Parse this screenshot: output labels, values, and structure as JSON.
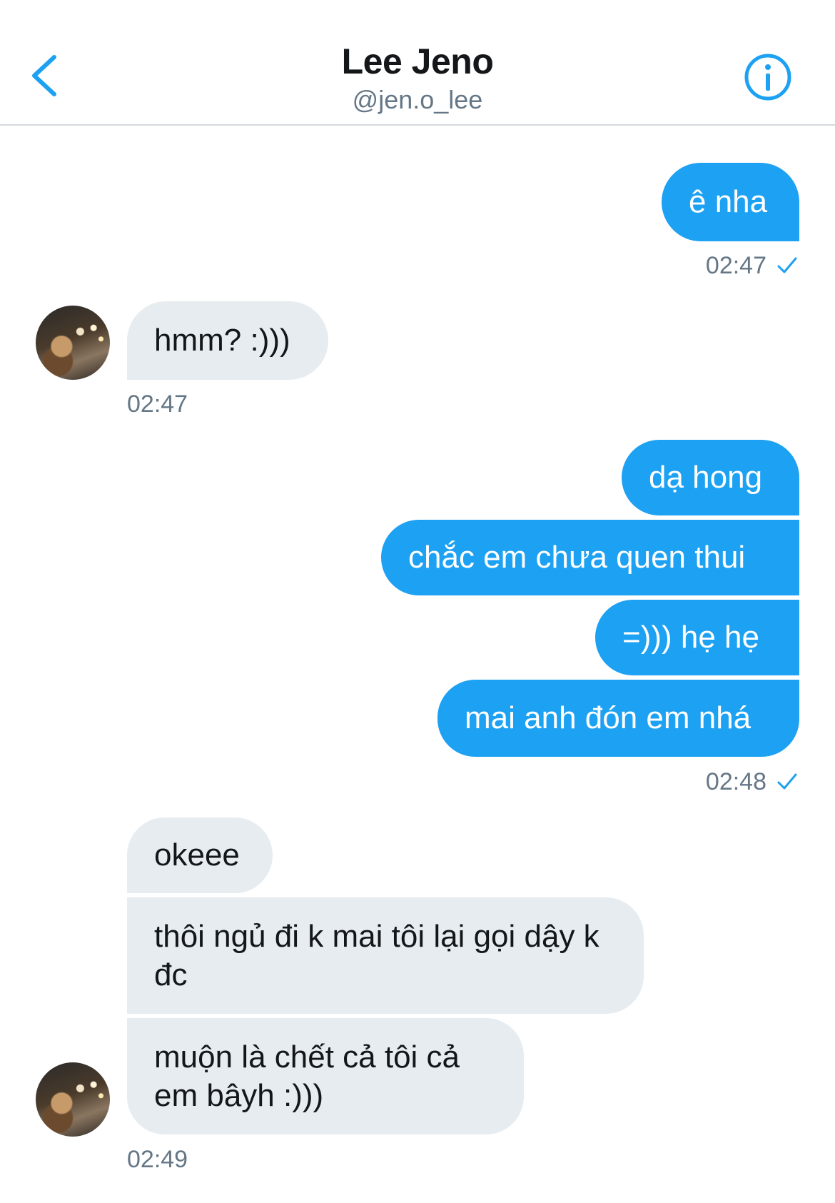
{
  "header": {
    "title": "Lee Jeno",
    "handle": "@jen.o_lee",
    "back_icon": "chevron-left-icon",
    "info_icon": "info-icon",
    "accent_color": "#1da1f2"
  },
  "messages": {
    "m1": "ê nha",
    "t1": "02:47",
    "m2": "hmm? :)))",
    "t2": "02:47",
    "m3": "dạ hong",
    "m4": "chắc em chưa quen thui",
    "m5": "=))) hẹ hẹ",
    "m6": "mai anh đón em nhá",
    "t3": "02:48",
    "m7": "okeee",
    "m8": "thôi ngủ đi k mai tôi lại gọi dậy k đc",
    "m9": "muộn là chết cả tôi cả em bâyh :)))",
    "t4": "02:49"
  },
  "colors": {
    "outgoing_bubble": "#1da1f2",
    "incoming_bubble": "#e6ecf0",
    "timestamp": "#657786"
  }
}
